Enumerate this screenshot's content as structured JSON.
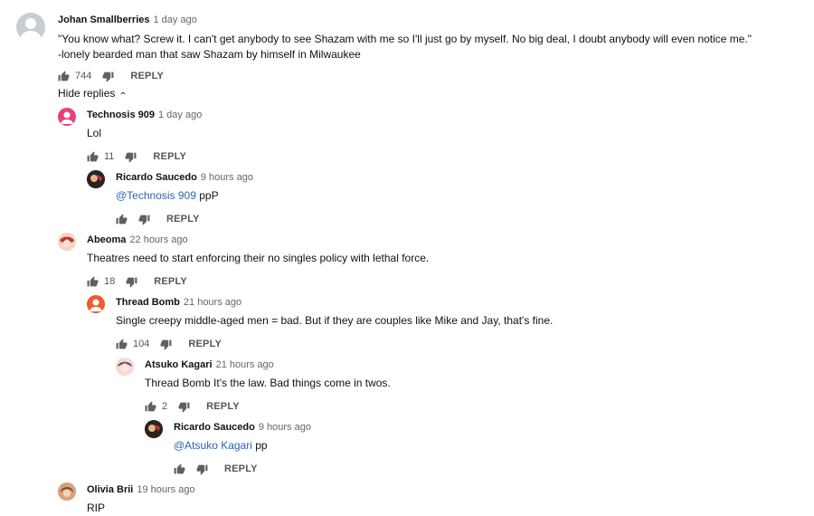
{
  "labels": {
    "reply": "REPLY",
    "hide_replies": "Hide replies"
  },
  "comments": [
    {
      "author": "Johan Smallberries",
      "time": "1 day ago",
      "lines": [
        "\"You know what? Screw it. I can't get anybody to see Shazam with me so I'll just go by myself. No big deal, I doubt anybody will even notice me.\"",
        "-lonely bearded man that saw Shazam by himself in Milwaukee"
      ],
      "likes": "744",
      "avatar_color": "#c7cdd3"
    },
    {
      "author": "Technosis 909",
      "time": "1 day ago",
      "text": "Lol",
      "likes": "11",
      "avatar_color": "#e9407a"
    },
    {
      "author": "Ricardo Saucedo",
      "time": "9 hours ago",
      "mention": "@Technosis 909",
      "text": " ppP",
      "likes": "",
      "avatar_color": "#2b2320"
    },
    {
      "author": "Abeoma",
      "time": "22 hours ago",
      "text": "Theatres need to start enforcing their no singles policy with lethal force.",
      "likes": "18",
      "avatar_color": "#d9786a"
    },
    {
      "author": "Thread Bomb",
      "time": "21 hours ago",
      "text": "Single creepy middle-aged men = bad. But if they are couples like Mike and Jay, that's fine.",
      "likes": "104",
      "avatar_color": "#f05a2c"
    },
    {
      "author": "Atsuko Kagari",
      "time": "21 hours ago",
      "text": "Thread Bomb It's the law.  Bad things come in twos.",
      "likes": "2",
      "avatar_color": "#e8b9a8"
    },
    {
      "author": "Ricardo Saucedo",
      "time": "9 hours ago",
      "mention": "@Atsuko Kagari",
      "text": " pp",
      "likes": "",
      "avatar_color": "#2b2320"
    },
    {
      "author": "Olivia Brii",
      "time": "19 hours ago",
      "text": "RIP",
      "avatar_color": "#c98a5a"
    }
  ]
}
